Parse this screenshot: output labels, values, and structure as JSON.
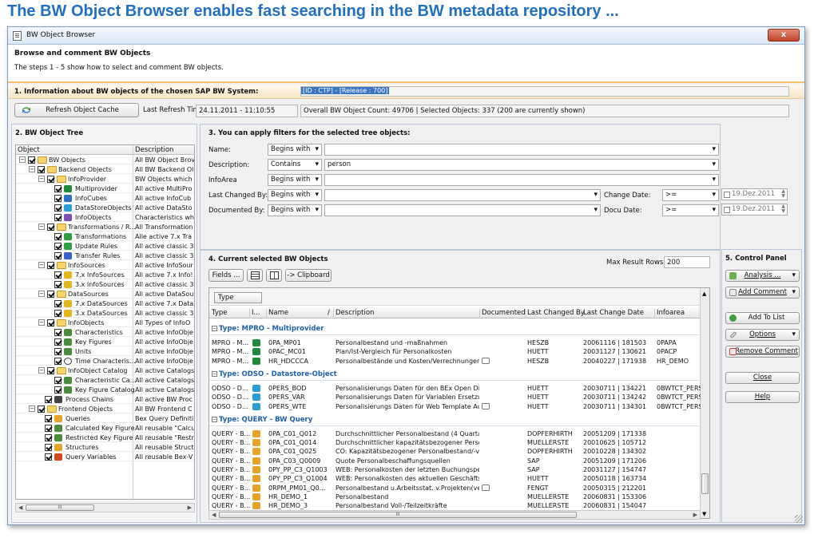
{
  "caption": "The BW Object Browser enables fast searching in the BW metadata repository ...",
  "window": {
    "title": "BW Object Browser",
    "close_label": "x"
  },
  "intro": {
    "heading": "Browse and comment BW Objects",
    "text": "The steps 1 - 5 show how to select and comment BW objects."
  },
  "info": {
    "heading": "1. Information about BW objects of the chosen SAP BW System:",
    "system": "[ID : CTP] - [Release : 700]",
    "refresh_label": "Refresh Object Cache",
    "last_refresh_label": "Last Refresh Time:",
    "last_refresh_value": "24.11.2011 - 11:10:55",
    "summary": "Overall BW Object Count: 49706 | Selected Objects: 337 (200 are currently shown)"
  },
  "tree": {
    "heading": "2. BW Object Tree",
    "col_object": "Object",
    "col_desc": "Description",
    "rows": [
      {
        "label": "BW Objects",
        "desc": "All BW Object Brov",
        "level": 0,
        "kind": "folder"
      },
      {
        "label": "Backend Objects",
        "desc": "All BW Backend Ol",
        "level": 1,
        "kind": "folder"
      },
      {
        "label": "InfoProvider",
        "desc": "BW Objects which",
        "level": 2,
        "kind": "folder"
      },
      {
        "label": "Multiprovider",
        "desc": "All active MultiPro",
        "level": 3,
        "kind": "mpro"
      },
      {
        "label": "InfoCubes",
        "desc": "All active InfoCub",
        "level": 3,
        "kind": "cube"
      },
      {
        "label": "DataStoreObjects",
        "desc": "All active DataSto",
        "level": 3,
        "kind": "dso"
      },
      {
        "label": "InfoObjects",
        "desc": "Characteristics wh",
        "level": 3,
        "kind": "iobj"
      },
      {
        "label": "Transformations / R...",
        "desc": "All Transformation",
        "level": 2,
        "kind": "folder"
      },
      {
        "label": "Transformations",
        "desc": "Alle active 7.x Tra",
        "level": 3,
        "kind": "trans"
      },
      {
        "label": "Update Rules",
        "desc": "All active classic 3",
        "level": 3,
        "kind": "trans"
      },
      {
        "label": "Transfer Rules",
        "desc": "All active classic 3",
        "level": 3,
        "kind": "trans2"
      },
      {
        "label": "InfoSources",
        "desc": "All active InfoSour",
        "level": 2,
        "kind": "folder"
      },
      {
        "label": "7.x InfoSources",
        "desc": "All active 7.x Info!",
        "level": 3,
        "kind": "isrc"
      },
      {
        "label": "3.x InfoSources",
        "desc": "All active classic 3",
        "level": 3,
        "kind": "isrc"
      },
      {
        "label": "DataSources",
        "desc": "All active DataSour",
        "level": 2,
        "kind": "folder"
      },
      {
        "label": "7.x DataSources",
        "desc": "All active 7.x Data",
        "level": 3,
        "kind": "isrc"
      },
      {
        "label": "3.x DataSources",
        "desc": "All active classic 3",
        "level": 3,
        "kind": "isrc"
      },
      {
        "label": "InfoObjects",
        "desc": "All Types of InfoO",
        "level": 2,
        "kind": "folder"
      },
      {
        "label": "Characteristics",
        "desc": "All active InfoObje",
        "level": 3,
        "kind": "table"
      },
      {
        "label": "Key Figures",
        "desc": "All active InfoObje",
        "level": 3,
        "kind": "table"
      },
      {
        "label": "Units",
        "desc": "All active InfoObje",
        "level": 3,
        "kind": "table"
      },
      {
        "label": "Time Characteris...",
        "desc": "All active InfoObje",
        "level": 3,
        "kind": "clock"
      },
      {
        "label": "InfoObject Catalog",
        "desc": "All active Catalogs",
        "level": 2,
        "kind": "folder"
      },
      {
        "label": "Characteristic Ca...",
        "desc": "All active Catalogs",
        "level": 3,
        "kind": "table"
      },
      {
        "label": "Key Figure Catalog",
        "desc": "All active Catalogs",
        "level": 3,
        "kind": "table"
      },
      {
        "label": "Process Chains",
        "desc": "All active BW Proc",
        "level": 2,
        "kind": "chain"
      },
      {
        "label": "Frontend Objects",
        "desc": "All BW Frontend C",
        "level": 1,
        "kind": "folder"
      },
      {
        "label": "Queries",
        "desc": "Bex Query Definiti",
        "level": 2,
        "kind": "query"
      },
      {
        "label": "Calculated Key Figure",
        "desc": "All reusable \"Calcu",
        "level": 2,
        "kind": "table"
      },
      {
        "label": "Restricted Key Figure",
        "desc": "All reusable \"Restr",
        "level": 2,
        "kind": "table"
      },
      {
        "label": "Structures",
        "desc": "All reusable Struct",
        "level": 2,
        "kind": "query"
      },
      {
        "label": "Query Variables",
        "desc": "All reusable Bex-V",
        "level": 2,
        "kind": "var"
      }
    ],
    "scroll_thumb": "III"
  },
  "filters": {
    "heading": "3. You can apply filters for the selected tree objects:",
    "name_label": "Name:",
    "name_op": "Begins with",
    "name_value": "",
    "desc_label": "Description:",
    "desc_op": "Contains",
    "desc_value": "person",
    "area_label": "InfoArea",
    "area_op": "Begins with",
    "changed_label": "Last Changed By:",
    "changed_op": "Begins with",
    "documented_label": "Documented By:",
    "documented_op": "Begins with",
    "change_date_label": "Change Date:",
    "change_date_op": ">=",
    "change_date_value": "19.Dez.2011",
    "docu_date_label": "Docu Date:",
    "docu_date_op": ">=",
    "docu_date_value": "19.Dez.2011"
  },
  "results": {
    "heading": "4. Current selected BW Objects",
    "max_rows_label": "Max Result Rows:",
    "max_rows_value": "200",
    "fields_label": "Fields ...",
    "clipboard_label": "-> Clipboard",
    "group_chip": "Type",
    "columns": [
      "Type",
      "I...",
      "Name",
      "/",
      "Description",
      "Documented",
      "Last Changed By",
      "Last Change Date",
      "Infoarea"
    ],
    "groups": [
      {
        "title": "Type: MPRO - Multiprovider",
        "icon": "mpro",
        "rows": [
          {
            "type": "MPRO - M...",
            "name": "0PA_MP01",
            "desc": "Personalbestand und -maßnahmen",
            "doc": false,
            "by": "HESZB",
            "date": "20061116 | 181503",
            "area": "0PAPA"
          },
          {
            "type": "MPRO - M...",
            "name": "0PAC_MC01",
            "desc": "Plan/Ist-Vergleich für Personalkosten",
            "doc": false,
            "by": "HUETT",
            "date": "20031127 | 130621",
            "area": "0PACP"
          },
          {
            "type": "MPRO - M...",
            "name": "HR_HDCCCA",
            "desc": "Personalbestände und Kosten/Verrechnungen",
            "doc": true,
            "by": "HESZB",
            "date": "20040227 | 171938",
            "area": "HR_DEMO"
          }
        ]
      },
      {
        "title": "Type: ODSO - Datastore-Object",
        "icon": "dso",
        "rows": [
          {
            "type": "ODSO - D...",
            "name": "0PERS_BOD",
            "desc": "Personalisierungs Daten für den BEx Open Dialog",
            "doc": false,
            "by": "HUETT",
            "date": "20030711 | 134221",
            "area": "0BWTCT_PERS"
          },
          {
            "type": "ODSO - D...",
            "name": "0PERS_VAR",
            "desc": "Personalisierungs Daten für Variablen Ersetzung",
            "doc": false,
            "by": "HUETT",
            "date": "20030711 | 134242",
            "area": "0BWTCT_PERS"
          },
          {
            "type": "ODSO - D...",
            "name": "0PERS_WTE",
            "desc": "Personalisierungs Daten für Web Template Aufri...",
            "doc": true,
            "by": "HUETT",
            "date": "20030711 | 134301",
            "area": "0BWTCT_PERS"
          }
        ]
      },
      {
        "title": "Type: QUERY - BW Query",
        "icon": "query",
        "rows": [
          {
            "type": "QUERY - B...",
            "name": "0PA_C01_Q012",
            "desc": "Durchschnittlicher Personalbestand (4 Quartale)",
            "doc": false,
            "by": "DOPFERHIRTH",
            "date": "20051209 | 171338",
            "area": ""
          },
          {
            "type": "QUERY - B...",
            "name": "0PA_C01_Q014",
            "desc": "Durchschnittlicher kapazitätsbezogener Persona...",
            "doc": false,
            "by": "MUELLERSTE",
            "date": "20010625 | 105712",
            "area": ""
          },
          {
            "type": "QUERY - B...",
            "name": "0PA_C01_Q025",
            "desc": "CO: Kapazitätsbezogener Personalbestand/-ver...",
            "doc": false,
            "by": "DOPFERHIRTH",
            "date": "20010228 | 134302",
            "area": ""
          },
          {
            "type": "QUERY - B...",
            "name": "0PA_C03_Q0009",
            "desc": "Quote Personalbeschaffungsquellen",
            "doc": false,
            "by": "SAP",
            "date": "20051209 | 171206",
            "area": ""
          },
          {
            "type": "QUERY - B...",
            "name": "0PY_PP_C3_Q1003",
            "desc": "WEB: Personalkosten der letzten Buchungsperiode",
            "doc": false,
            "by": "SAP",
            "date": "20031127 | 154747",
            "area": ""
          },
          {
            "type": "QUERY - B...",
            "name": "0PY_PP_C3_Q1004",
            "desc": "WEB: Personalkosten des aktuellen Geschäftsja...",
            "doc": false,
            "by": "HUETT",
            "date": "20050118 | 163734",
            "area": ""
          },
          {
            "type": "QUERY - B...",
            "name": "0RPM_PM01_Q0...",
            "desc": "Personalbestand u.Arbeitsstat. v.Projekten(ver...",
            "doc": true,
            "by": "FENGT",
            "date": "20050315 | 212201",
            "area": ""
          },
          {
            "type": "QUERY - B...",
            "name": "HR_DEMO_1",
            "desc": "Personalbestand",
            "doc": false,
            "by": "MUELLERSTE",
            "date": "20060831 | 153306",
            "area": ""
          },
          {
            "type": "QUERY - B...",
            "name": "HR_DEMO_3",
            "desc": "Personalbestand Voll-/Teilzeitkräfte",
            "doc": false,
            "by": "MUELLERSTE",
            "date": "20060831 | 154047",
            "area": ""
          }
        ]
      }
    ],
    "scroll_thumb": "III"
  },
  "control": {
    "heading": "5. Control Panel",
    "analysis": "Analysis ...",
    "add_comment": "Add Comment",
    "add_list": "Add To List",
    "options": "Options",
    "remove_comment": "Remove Comment",
    "close": "Close",
    "help": "Help"
  },
  "colors": {
    "caption": "#1f6fc3",
    "group_title": "#1f5fae",
    "accent_line": "#f3c069"
  }
}
